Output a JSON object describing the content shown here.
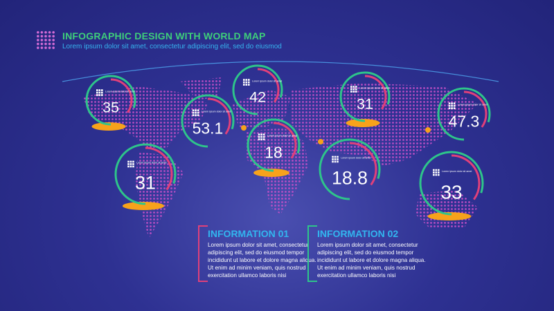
{
  "header": {
    "title": "INFOGRAPHIC DESIGN WITH WORLD MAP",
    "subtitle": "Lorem ipsum dolor sit amet, consectetur adipiscing elit, sed do eiusmod"
  },
  "colors": {
    "background": "#2e3192",
    "title": "#3ecf7a",
    "accent_blue": "#32b6ef",
    "ring_green": "#2ec58a",
    "ring_pink": "#e0407a",
    "map_dots": "#c64fc8",
    "pedestal": "#f7a21b"
  },
  "bubbles": [
    {
      "value": "35",
      "caption": "Lorem ipsum dolor sit amet, consectetur adipiscing elit"
    },
    {
      "value": "53.1",
      "caption": "Lorem ipsum dolor sit amet, consectetur adipiscing elit"
    },
    {
      "value": "42",
      "caption": "Lorem ipsum dolor sit amet, consectetur adipiscing elit"
    },
    {
      "value": "18",
      "caption": "Lorem ipsum dolor sit amet, consectetur adipiscing elit"
    },
    {
      "value": "31",
      "caption": "Lorem ipsum dolor sit amet, consectetur adipiscing elit"
    },
    {
      "value": "47.3",
      "caption": "Lorem ipsum dolor sit amet, consectetur adipiscing elit"
    },
    {
      "value": "31",
      "caption": "Lorem ipsum dolor sit amet, consectetur adipiscing elit"
    },
    {
      "value": "18.8",
      "caption": "Lorem ipsum dolor sit amet, consectetur adipiscing elit"
    },
    {
      "value": "33",
      "caption": "Lorem ipsum dolor sit amet, consectetur adipiscing elit"
    }
  ],
  "info": [
    {
      "title": "INFORMATION 01",
      "text": "Lorem ipsum dolor sit amet, consectetur adipiscing elit, sed do eiusmod tempor incididunt ut labore et dolore magna aliqua. Ut enim ad minim veniam, quis nostrud exercitation ullamco laboris nisi"
    },
    {
      "title": "INFORMATION 02",
      "text": "Lorem ipsum dolor sit amet, consectetur adipiscing elit, sed do eiusmod tempor incididunt ut labore et dolore magna aliqua. Ut enim ad minim veniam, quis nostrud exercitation ullamco laboris nisi"
    }
  ]
}
